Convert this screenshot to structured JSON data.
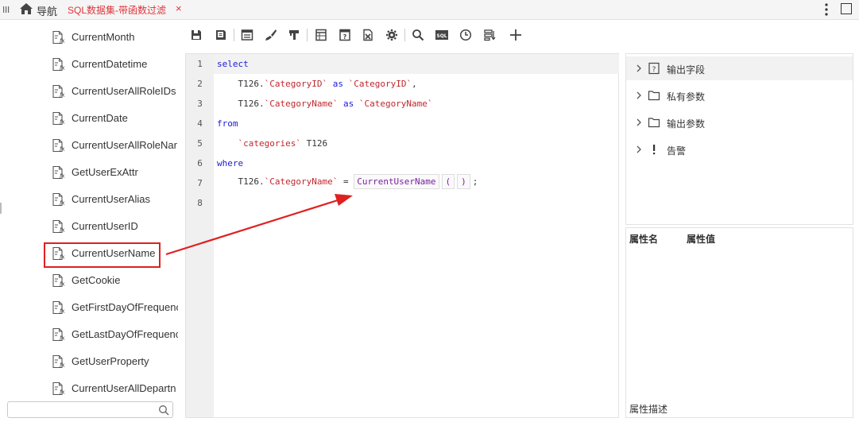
{
  "topbar": {
    "nav_label": "导航",
    "tab_title": "SQL数据集-带函数过滤",
    "close_glyph": "×"
  },
  "function_list": [
    "CurrentMonth",
    "CurrentDatetime",
    "CurrentUserAllRoleIDs",
    "CurrentDate",
    "CurrentUserAllRoleNar",
    "GetUserExAttr",
    "CurrentUserAlias",
    "CurrentUserID",
    "CurrentUserName",
    "GetCookie",
    "GetFirstDayOfFrequenc",
    "GetLastDayOfFrequenc",
    "GetUserProperty",
    "CurrentUserAllDepartn"
  ],
  "highlighted_function": "CurrentUserName",
  "toolbar_icons": [
    "save-icon",
    "save-as-icon",
    "layout-icon",
    "format-brush-icon",
    "filter-icon",
    "table-icon",
    "help-doc-icon",
    "export-icon",
    "settings-icon",
    "search-icon",
    "sql-icon",
    "clock-icon",
    "sort-icon",
    "add-icon"
  ],
  "editor": {
    "line_numbers": [
      "1",
      "2",
      "3",
      "4",
      "5",
      "6",
      "7",
      "8"
    ],
    "line1": "select",
    "line2_prefix": "    T126.",
    "line2_col": "`CategoryID`",
    "line2_as": "as",
    "line2_alias": "`CategoryID`",
    "line2_end": ",",
    "line3_prefix": "    T126.",
    "line3_col": "`CategoryName`",
    "line3_as": "as",
    "line3_alias": "`CategoryName`",
    "line4": "from",
    "line5_table": "`categories`",
    "line5_alias": " T126",
    "line6": "where",
    "line7_prefix": "    T126.",
    "line7_col": "`CategoryName`",
    "line7_eq": " = ",
    "line7_fn": "CurrentUserName",
    "line7_lparen": "(",
    "line7_rparen": ")",
    "line7_end": ";"
  },
  "right_tree": [
    {
      "label": "输出字段",
      "icon": "field-help-icon"
    },
    {
      "label": "私有参数",
      "icon": "folder-icon"
    },
    {
      "label": "输出参数",
      "icon": "folder-icon"
    },
    {
      "label": "告警",
      "icon": "exclamation-icon"
    }
  ],
  "properties": {
    "name_header": "属性名",
    "value_header": "属性值",
    "description_label": "属性描述"
  },
  "colors": {
    "tab_active": "#e0343a",
    "keyword": "#1a1ad6",
    "identifier": "#c1272d",
    "function_token": "#7b1fa2",
    "annotation_red": "#e02020"
  }
}
